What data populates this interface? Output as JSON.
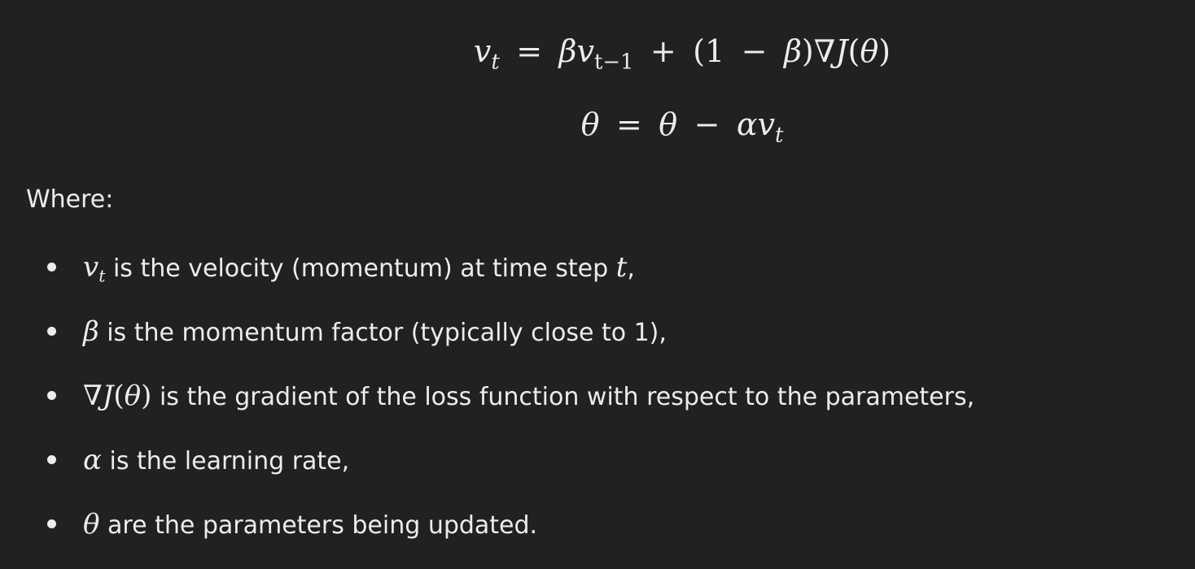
{
  "equations": {
    "velocity_update": {
      "lhs": "v",
      "lhs_sub": "t",
      "eq": "=",
      "beta": "β",
      "v": "v",
      "v_sub": "t−1",
      "plus": "+",
      "paren_open": "(1",
      "minus": "−",
      "beta2": "β",
      "paren_close": ")",
      "nabla": "∇",
      "J": "J",
      "theta_open": "(",
      "theta": "θ",
      "theta_close": ")"
    },
    "param_update": {
      "theta_lhs": "θ",
      "eq": "=",
      "theta_rhs": "θ",
      "minus": "−",
      "alpha": "α",
      "v": "v",
      "v_sub": "t"
    }
  },
  "where_label": "Where:",
  "definitions": [
    {
      "sym": "v",
      "sym_sub": "t",
      "text": " is the velocity (momentum) at time step ",
      "tail_sym": "t",
      "tail": ","
    },
    {
      "sym": "β",
      "text": " is the momentum factor (typically close to 1),"
    },
    {
      "sym_nabla": "∇",
      "sym": "J",
      "sym_paren_open": "(",
      "sym_theta": "θ",
      "sym_paren_close": ")",
      "text": " is the gradient of the loss function with respect to the parameters,"
    },
    {
      "sym": "α",
      "text": " is the learning rate,"
    },
    {
      "sym": "θ",
      "text": " are the parameters being updated."
    }
  ]
}
